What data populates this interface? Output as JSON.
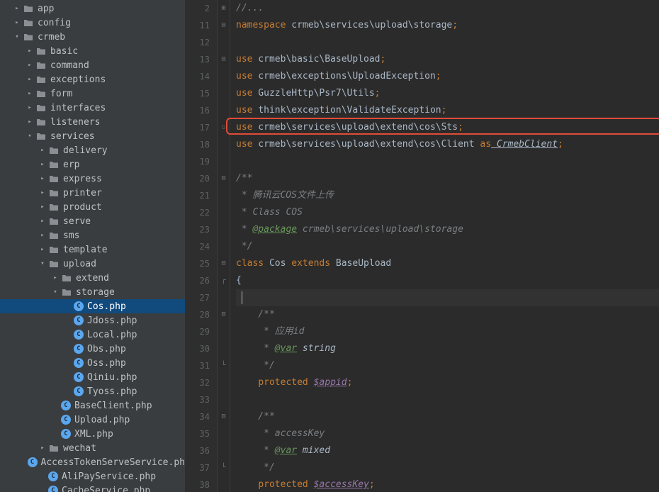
{
  "tree": [
    {
      "depth": 0,
      "arrow": "right",
      "icon": "folder",
      "label": "app"
    },
    {
      "depth": 0,
      "arrow": "right",
      "icon": "folder",
      "label": "config"
    },
    {
      "depth": 0,
      "arrow": "down",
      "icon": "folder",
      "label": "crmeb"
    },
    {
      "depth": 1,
      "arrow": "right",
      "icon": "folder",
      "label": "basic"
    },
    {
      "depth": 1,
      "arrow": "right",
      "icon": "folder",
      "label": "command"
    },
    {
      "depth": 1,
      "arrow": "right",
      "icon": "folder",
      "label": "exceptions"
    },
    {
      "depth": 1,
      "arrow": "right",
      "icon": "folder",
      "label": "form"
    },
    {
      "depth": 1,
      "arrow": "right",
      "icon": "folder",
      "label": "interfaces"
    },
    {
      "depth": 1,
      "arrow": "right",
      "icon": "folder",
      "label": "listeners"
    },
    {
      "depth": 1,
      "arrow": "down",
      "icon": "folder",
      "label": "services"
    },
    {
      "depth": 2,
      "arrow": "right",
      "icon": "folder",
      "label": "delivery"
    },
    {
      "depth": 2,
      "arrow": "right",
      "icon": "folder",
      "label": "erp"
    },
    {
      "depth": 2,
      "arrow": "right",
      "icon": "folder",
      "label": "express"
    },
    {
      "depth": 2,
      "arrow": "right",
      "icon": "folder",
      "label": "printer"
    },
    {
      "depth": 2,
      "arrow": "right",
      "icon": "folder",
      "label": "product"
    },
    {
      "depth": 2,
      "arrow": "right",
      "icon": "folder",
      "label": "serve"
    },
    {
      "depth": 2,
      "arrow": "right",
      "icon": "folder",
      "label": "sms"
    },
    {
      "depth": 2,
      "arrow": "right",
      "icon": "folder",
      "label": "template"
    },
    {
      "depth": 2,
      "arrow": "down",
      "icon": "folder",
      "label": "upload"
    },
    {
      "depth": 3,
      "arrow": "right",
      "icon": "folder",
      "label": "extend"
    },
    {
      "depth": 3,
      "arrow": "down",
      "icon": "folder",
      "label": "storage"
    },
    {
      "depth": 4,
      "arrow": "",
      "icon": "php",
      "label": "Cos.php",
      "selected": true
    },
    {
      "depth": 4,
      "arrow": "",
      "icon": "php",
      "label": "Jdoss.php"
    },
    {
      "depth": 4,
      "arrow": "",
      "icon": "php",
      "label": "Local.php"
    },
    {
      "depth": 4,
      "arrow": "",
      "icon": "php",
      "label": "Obs.php"
    },
    {
      "depth": 4,
      "arrow": "",
      "icon": "php",
      "label": "Oss.php"
    },
    {
      "depth": 4,
      "arrow": "",
      "icon": "php",
      "label": "Qiniu.php"
    },
    {
      "depth": 4,
      "arrow": "",
      "icon": "php",
      "label": "Tyoss.php"
    },
    {
      "depth": 3,
      "arrow": "",
      "icon": "php",
      "label": "BaseClient.php"
    },
    {
      "depth": 3,
      "arrow": "",
      "icon": "php",
      "label": "Upload.php"
    },
    {
      "depth": 3,
      "arrow": "",
      "icon": "php",
      "label": "XML.php"
    },
    {
      "depth": 2,
      "arrow": "right",
      "icon": "folder",
      "label": "wechat"
    },
    {
      "depth": 2,
      "arrow": "",
      "icon": "php",
      "label": "AccessTokenServeService.ph"
    },
    {
      "depth": 2,
      "arrow": "",
      "icon": "php",
      "label": "AliPayService.php"
    },
    {
      "depth": 2,
      "arrow": "",
      "icon": "php",
      "label": "CacheService.php"
    }
  ],
  "gutter_start": 2,
  "gutter_end": 38,
  "fold": {
    "2": "plus",
    "11": "minus",
    "13": "minus",
    "17": "box",
    "20": "minus",
    "25": "minus",
    "26": "topen",
    "28": "minus",
    "31": "tclose",
    "34": "minus",
    "37": "tclose"
  },
  "code": {
    "l2": {
      "cm": "//..."
    },
    "l11": {
      "kw": "namespace",
      "ns": " crmeb\\services\\upload\\storage",
      "sc": ";"
    },
    "l13": {
      "kw": "use",
      "ns": " crmeb\\basic\\BaseUpload",
      "sc": ";"
    },
    "l14": {
      "kw": "use",
      "ns": " crmeb\\exceptions\\UploadException",
      "sc": ";"
    },
    "l15": {
      "kw": "use",
      "ns": " GuzzleHttp\\Psr7\\Utils",
      "sc": ";"
    },
    "l16": {
      "kw": "use",
      "ns": " think\\exception\\ValidateException",
      "sc": ";"
    },
    "l17": {
      "kw": "use",
      "ns": " crmeb\\services\\upload\\extend\\cos\\Sts",
      "sc": ";"
    },
    "l18": {
      "kw": "use",
      "ns": " crmeb\\services\\upload\\extend\\cos\\Client ",
      "as": "as",
      "alias": " CrmebClient",
      "sc": ";"
    },
    "l20": {
      "docg": "/**"
    },
    "l21": {
      "docg": " * 腾讯云COS文件上传"
    },
    "l22": {
      "docg": " * Class COS"
    },
    "l23": {
      "docg_a": " * ",
      "tag": "@package",
      "docg_b": " crmeb\\services\\upload\\storage"
    },
    "l24": {
      "docg": " */"
    },
    "l25": {
      "kw1": "class",
      "cls": " Cos ",
      "kw2": "extends",
      "base": " BaseUpload"
    },
    "l26": {
      "br": "{"
    },
    "l28": {
      "docg": "    /**"
    },
    "l29": {
      "docg": "     * 应用id"
    },
    "l30": {
      "docg_a": "     * ",
      "tag": "@var",
      "type": " string"
    },
    "l31": {
      "docg": "     */"
    },
    "l32": {
      "ind": "    ",
      "kw": "protected ",
      "var": "$appid",
      "sc": ";"
    },
    "l34": {
      "docg": "    /**"
    },
    "l35": {
      "docg": "     * accessKey"
    },
    "l36": {
      "docg_a": "     * ",
      "tag": "@var",
      "type": " mixed"
    },
    "l37": {
      "docg": "     */"
    },
    "l38": {
      "ind": "    ",
      "kw": "protected ",
      "var": "$accessKey",
      "sc": ";"
    }
  },
  "highlight": {
    "top_line": 17
  }
}
